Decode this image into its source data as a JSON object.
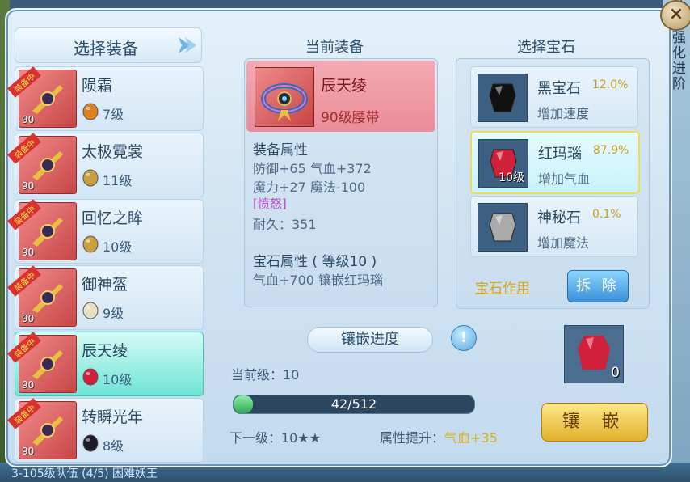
{
  "background": {
    "bottom_text": "3-105级队伍 (4/5) 困难妖王",
    "right_text": "装备强化进阶"
  },
  "close_label": "×",
  "left_panel": {
    "title": "选择装备",
    "items": [
      {
        "name": "陨霜",
        "level": "90",
        "gem_level": "7级",
        "gem_color": "#e08020",
        "badge": "装备中"
      },
      {
        "name": "太极霓裳",
        "level": "90",
        "gem_level": "11级",
        "gem_color": "#c8a040",
        "badge": "装备中"
      },
      {
        "name": "回忆之眸",
        "level": "90",
        "gem_level": "10级",
        "gem_color": "#c8a040",
        "badge": "装备中"
      },
      {
        "name": "御神盔",
        "level": "90",
        "gem_level": "9级",
        "gem_color": "#e8e0c0",
        "badge": "装备中"
      },
      {
        "name": "辰天绫",
        "level": "90",
        "gem_level": "10级",
        "gem_color": "#d0203a",
        "badge": "装备中"
      },
      {
        "name": "转瞬光年",
        "level": "90",
        "gem_level": "8级",
        "gem_color": "#1a1a28",
        "badge": "装备中"
      }
    ]
  },
  "current_equipment": {
    "title": "当前装备",
    "name": "辰天绫",
    "type": "90级腰带",
    "attr_title": "装备属性",
    "attr_line1": "防御+65 气血+372",
    "attr_line2": "魔力+27 魔法-100",
    "special": "[愤怒]",
    "durability": "耐久：351",
    "gem_attr_title": "宝石属性 ( 等级10 )",
    "gem_attr_line": "气血+700 镶嵌红玛瑙"
  },
  "gem_select": {
    "title": "选择宝石",
    "gems": [
      {
        "name": "黑宝石",
        "rate": "12.0%",
        "desc": "增加速度",
        "level": "",
        "color": "#111"
      },
      {
        "name": "红玛瑙",
        "rate": "87.9%",
        "desc": "增加气血",
        "level": "10级",
        "color": "#d0203a"
      },
      {
        "name": "神秘石",
        "rate": "0.1%",
        "desc": "增加魔法",
        "level": "",
        "color": "#aaa"
      }
    ],
    "effect_link": "宝石作用",
    "remove_button": "拆 除"
  },
  "progress": {
    "title": "镶嵌进度",
    "current_level": "当前级：10",
    "bar_text": "42/512",
    "bar_fraction": 0.082,
    "next_level": "下一级：10★★",
    "attr_label": "属性提升：",
    "attr_value": "气血+35"
  },
  "slot": {
    "count": "0"
  },
  "inlay_button": "镶 嵌"
}
